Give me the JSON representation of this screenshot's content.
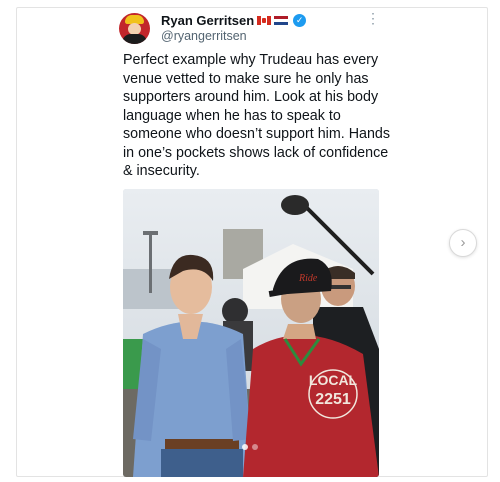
{
  "tweet": {
    "author_name": "Ryan Gerritsen",
    "handle": "@ryangerritsen",
    "flags": [
      "canada-flag",
      "netherlands-flag"
    ],
    "verified": true,
    "text": "Perfect example why Trudeau has every venue vetted to make sure he only has supporters around him. Look at his body language when he has to speak to someone who doesn’t support him. Hands in one’s pockets shows lack of confidence & insecurity.",
    "more_icon": "⋮",
    "photo_text": {
      "cap_logo": "Ride",
      "shirt_lines": [
        "LOCAL",
        "2251"
      ]
    }
  },
  "carousel": {
    "next_icon": "›"
  },
  "colors": {
    "verified_blue": "#1d9bf0",
    "text_primary": "#0f1419",
    "text_secondary": "#536471"
  }
}
